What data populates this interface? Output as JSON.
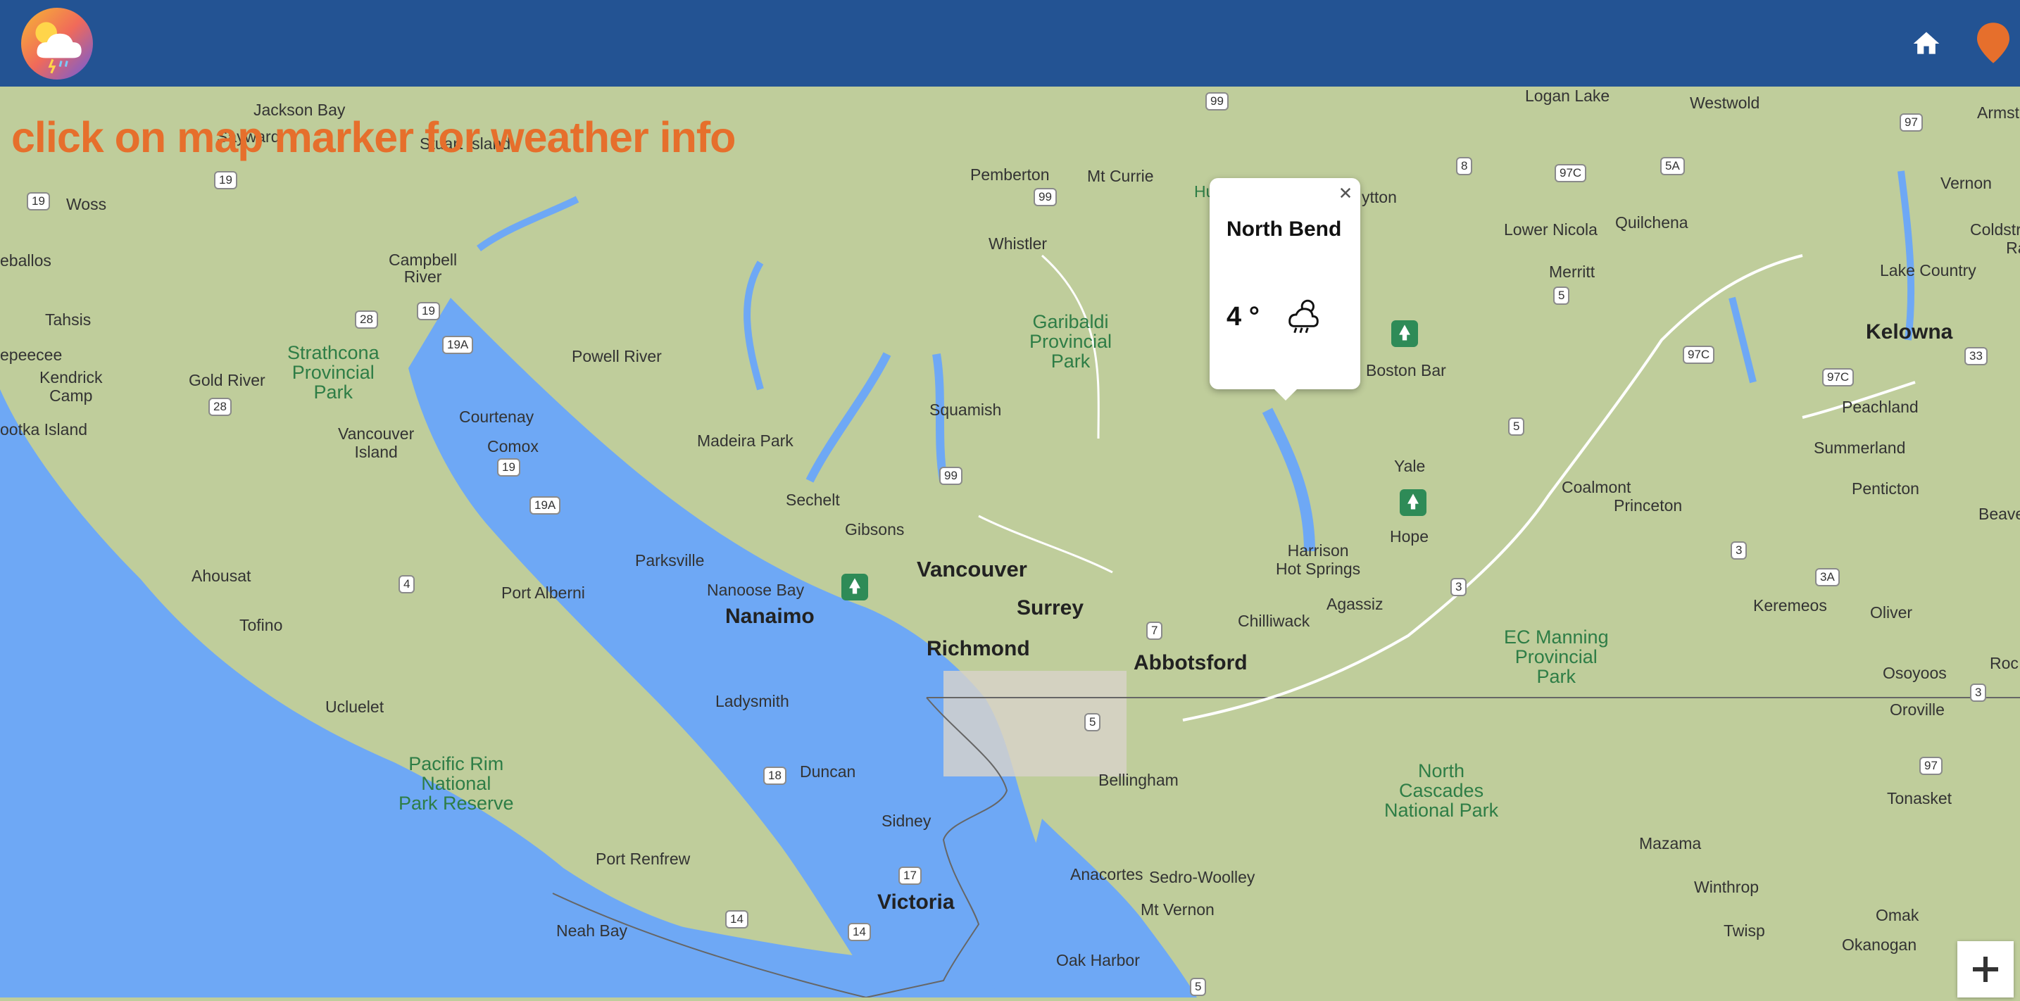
{
  "header": {
    "logo": "weather-app-logo-icon",
    "home_icon": "home-icon",
    "location_icon": "location-pin-icon",
    "background_color": "#235393"
  },
  "instruction": "click on map marker for weather info",
  "popup": {
    "city": "North Bend",
    "temperature": "4 °",
    "weather_icon": "cloud-sun-rain-icon",
    "close_icon": "close-icon"
  },
  "map": {
    "labels": {
      "jackson_bay": "Jackson Bay",
      "sayward": "Sayward",
      "stuart_island": "Stuart Island",
      "woss": "Woss",
      "campbell_river": "Campbell\nRiver",
      "zeballos": "eballos",
      "tahsis": "Tahsis",
      "strathcona": "Strathcona\nProvincial\nPark",
      "powell_river": "Powell River",
      "esperanza": "epeecee",
      "kendrick_camp": "Kendrick\nCamp",
      "gold_river": "Gold River",
      "nootka": "ootka Island",
      "courtenay": "Courtenay",
      "vancouver_island": "Vancouver\nIsland",
      "comox": "Comox",
      "madeira_park": "Madeira Park",
      "sechelt": "Sechelt",
      "gibsons": "Gibsons",
      "parksville": "Parksville",
      "ahousat": "Ahousat",
      "port_alberni": "Port Alberni",
      "nanoose_bay": "Nanoose Bay",
      "nanaimo": "Nanaimo",
      "tofino": "Tofino",
      "ucluelet": "Ucluelet",
      "ladysmith": "Ladysmith",
      "pacific_rim": "Pacific Rim\nNational\nPark Reserve",
      "duncan": "Duncan",
      "port_renfrew": "Port Renfrew",
      "sidney": "Sidney",
      "victoria": "Victoria",
      "neah_bay": "Neah Bay",
      "pemberton": "Pemberton",
      "mt_currie": "Mt Currie",
      "whistler": "Whistler",
      "garibaldi": "Garibaldi\nProvincial\nPark",
      "squamish": "Squamish",
      "vancouver": "Vancouver",
      "surrey": "Surrey",
      "richmond": "Richmond",
      "abbotsford": "Abbotsford",
      "chilliwack": "Chilliwack",
      "agassiz": "Agassiz",
      "harrison": "Harrison\nHot Springs",
      "hope": "Hope",
      "yale": "Yale",
      "boston_bar": "Boston Bar",
      "lytton": "ytton",
      "bellingham": "Bellingham",
      "anacortes": "Anacortes",
      "sedro_woolley": "Sedro-Woolley",
      "mt_vernon": "Mt Vernon",
      "oak_harbor": "Oak Harbor",
      "logan_lake": "Logan Lake",
      "westwold": "Westwold",
      "armstrong": "Armstrong",
      "lower_nicola": "Lower Nicola",
      "quilchena": "Quilchena",
      "merritt": "Merritt",
      "vernon": "Vernon",
      "coldstream": "Coldstream\nRanch",
      "lake_country": "Lake Country",
      "kelowna": "Kelowna",
      "peachland": "Peachland",
      "summerland": "Summerland",
      "coalmont": "Coalmont",
      "princeton": "Princeton",
      "penticton": "Penticton",
      "beaver": "Beave",
      "keremeos": "Keremeos",
      "oliver": "Oliver",
      "ec_manning": "EC Manning\nProvincial\nPark",
      "osoyoos": "Osoyoos",
      "rock": "Roc",
      "oroville": "Oroville",
      "north_cascades": "North\nCascades\nNational Park",
      "tonasket": "Tonasket",
      "mazama": "Mazama",
      "winthrop": "Winthrop",
      "twisp": "Twisp",
      "omak": "Omak",
      "okanogan": "Okanogan",
      "hand_partial": "Hu"
    },
    "shields": {
      "r99a": "99",
      "r8": "8",
      "r97c": "97C",
      "r5a": "5A",
      "r97": "97",
      "r19a": "19",
      "r19b": "19",
      "r19c": "19",
      "r28a": "28",
      "r28b": "28",
      "r19a2": "19A",
      "r99b": "99",
      "r5a2": "5",
      "r97c2": "97C",
      "r33": "33",
      "r97c3": "97C",
      "r5b": "5",
      "r19d": "19",
      "r19a3": "19A",
      "r99c": "99",
      "r4": "4",
      "r3a": "3",
      "r3b": "3",
      "r3aa": "3A",
      "r3c": "3",
      "r7": "7",
      "r5i": "5",
      "r18": "18",
      "r17": "17",
      "r14a": "14",
      "r14b": "14",
      "r97d": "97",
      "r5i2": "5"
    },
    "zoom_in": "+"
  }
}
